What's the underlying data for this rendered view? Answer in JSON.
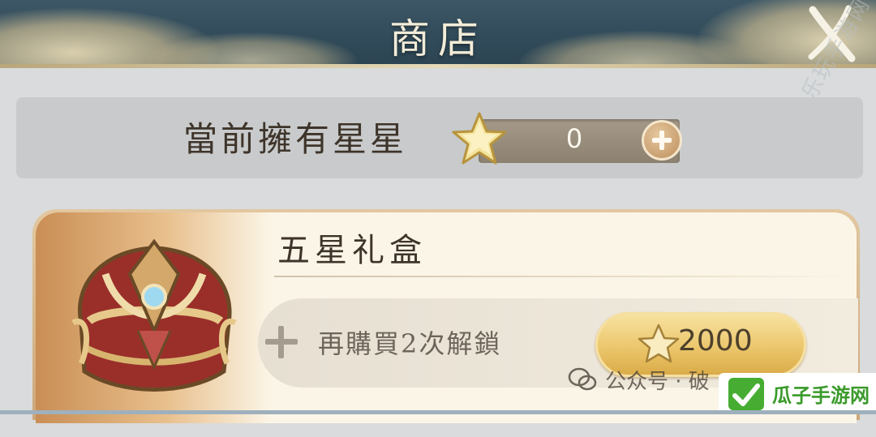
{
  "header": {
    "title": "商店",
    "close_icon": "close-x-icon"
  },
  "currency": {
    "label": "當前擁有星星",
    "icon": "star-icon",
    "value": "0",
    "add_icon": "plus-icon"
  },
  "item": {
    "name": "五星礼盒",
    "image_icon": "treasure-chest-icon",
    "unlock_icon": "plus-icon",
    "unlock_text": "再購買2次解鎖",
    "price_icon": "star-icon",
    "price": "2000"
  },
  "watermarks": {
    "site_mark": "乐玩手游网",
    "wechat_text": "公众号 · 破",
    "brand_name": "瓜子手游网"
  },
  "colors": {
    "header_bg": "#314b5a",
    "title_text": "#f3ecd8",
    "price_button": "#ebc66b",
    "brand_green": "#3a9a2a"
  }
}
